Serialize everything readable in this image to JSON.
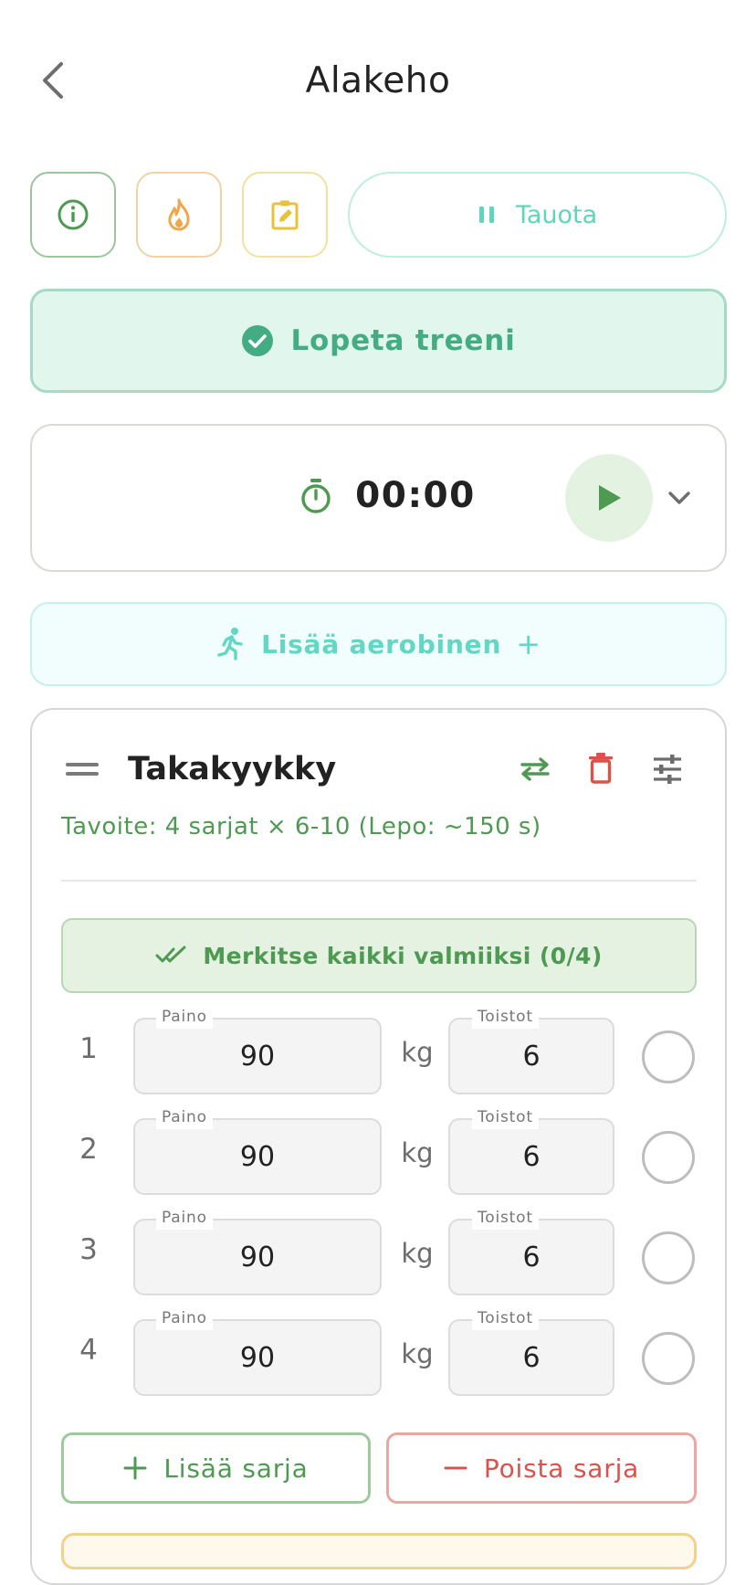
{
  "header": {
    "title": "Alakeho",
    "back_icon": "chevron-left-icon"
  },
  "toolbar": {
    "info_icon": "info-icon",
    "calories_icon": "fire-icon",
    "notes_icon": "note-edit-icon",
    "pause_label": "Tauota",
    "finish_label": "Lopeta treeni"
  },
  "timer": {
    "value": "00:00",
    "icon": "stopwatch-icon",
    "play_icon": "play-icon",
    "expand_icon": "chevron-down-icon"
  },
  "cardio": {
    "label": "Lisää aerobinen",
    "icon": "running-icon",
    "plus": "+"
  },
  "exercise": {
    "name": "Takakyykky",
    "target": "Tavoite: 4 sarjat × 6-10 (Lepo: ~150 s)",
    "mark_all_label": "Merkitse kaikki valmiiksi (0/4)",
    "weight_label": "Paino",
    "reps_label": "Toistot",
    "unit": "kg",
    "sets": [
      {
        "number": "1",
        "weight": "90",
        "reps": "6",
        "done": false
      },
      {
        "number": "2",
        "weight": "90",
        "reps": "6",
        "done": false
      },
      {
        "number": "3",
        "weight": "90",
        "reps": "6",
        "done": false
      },
      {
        "number": "4",
        "weight": "90",
        "reps": "6",
        "done": false
      }
    ],
    "add_set_label": "Lisää sarja",
    "remove_set_label": "Poista sarja"
  },
  "colors": {
    "accent_green": "#4e9a52",
    "teal": "#5fd6b9",
    "danger": "#d9534c",
    "amber": "#f0a64a"
  }
}
